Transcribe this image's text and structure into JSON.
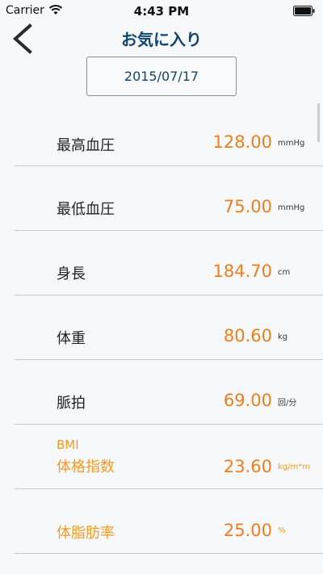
{
  "status_bar": {
    "carrier": "Carrier",
    "time": "4:43 PM"
  },
  "nav": {
    "title": "お気に入り"
  },
  "date": "2015/07/17",
  "rows": [
    {
      "label": "最高血圧",
      "value": "128.00",
      "unit": "mmHg"
    },
    {
      "label": "最低血圧",
      "value": "75.00",
      "unit": "mmHg"
    },
    {
      "label": "身長",
      "value": "184.70",
      "unit": "cm"
    },
    {
      "label": "体重",
      "value": "80.60",
      "unit": "kg"
    },
    {
      "label": "脈拍",
      "value": "69.00",
      "unit": "回/分"
    },
    {
      "sublabel": "BMI",
      "label": "体格指数",
      "value": "23.60",
      "unit": "kg/m*m"
    },
    {
      "label": "体脂肪率",
      "value": "25.00",
      "unit": "%"
    }
  ],
  "colors": {
    "title": "#12456b",
    "value": "#ee7d1a",
    "highlight_label": "#f29b22",
    "background": "#f7f8fa"
  }
}
